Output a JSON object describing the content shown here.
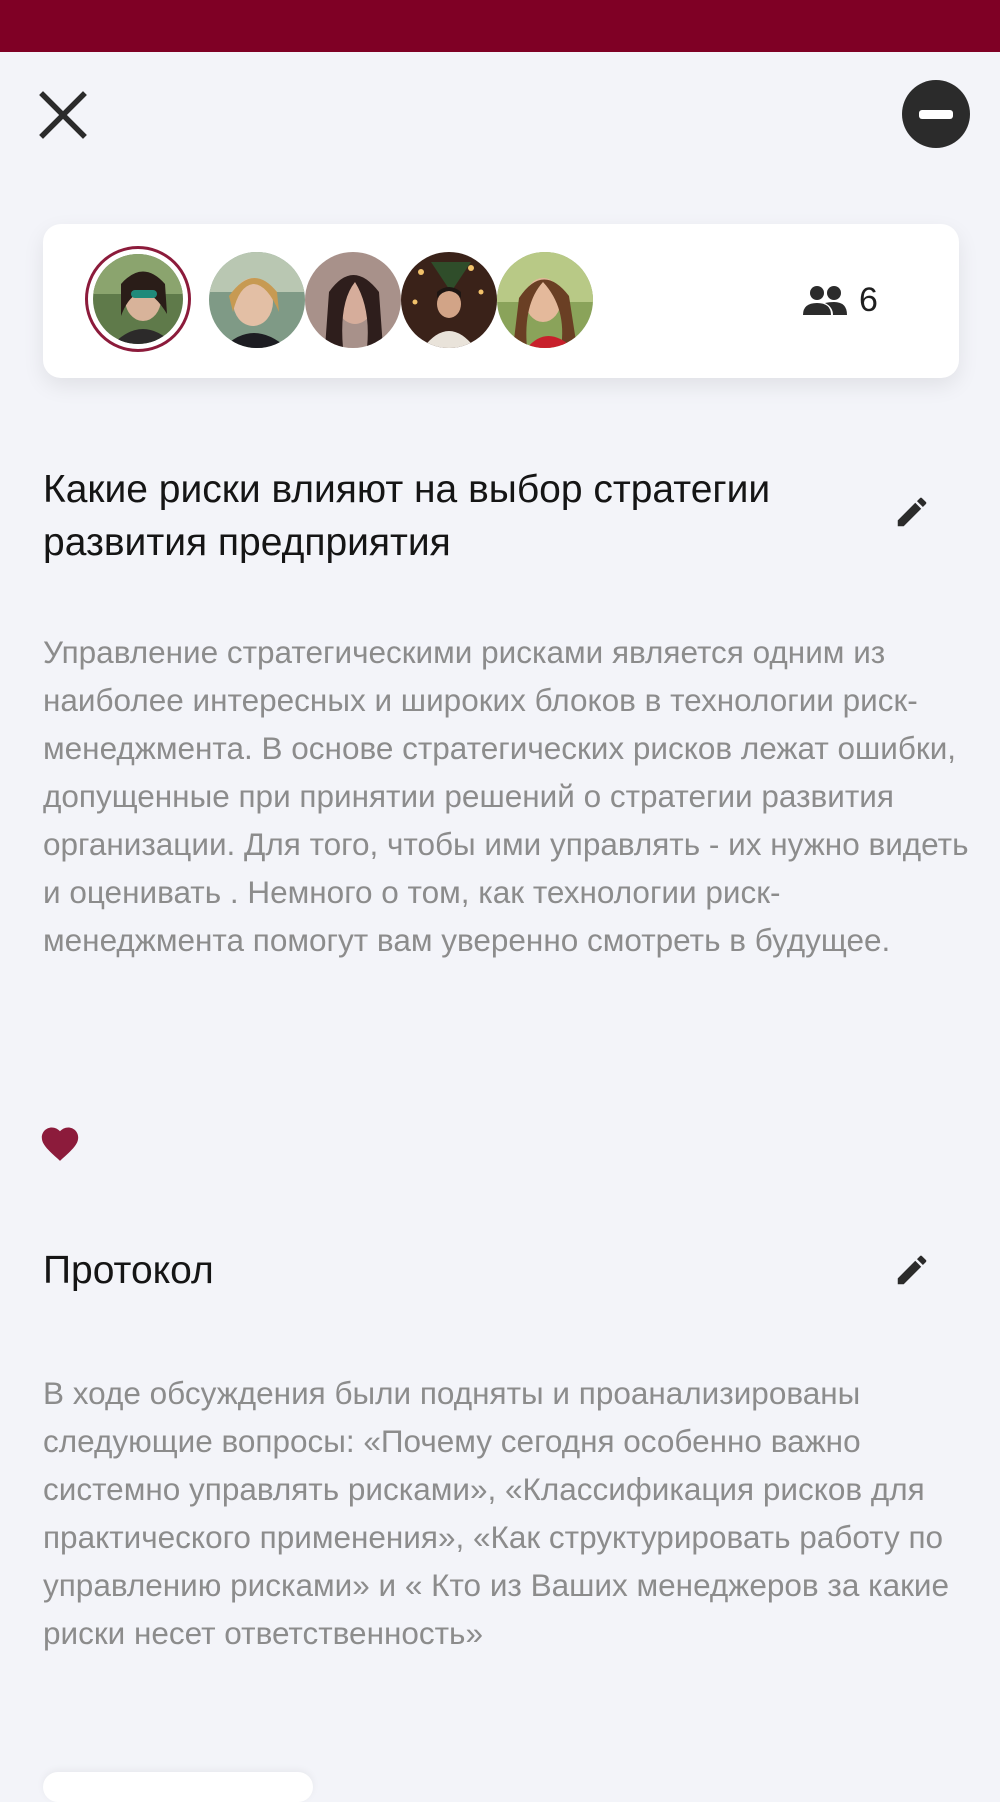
{
  "colors": {
    "status_bar": "#7f0025",
    "accent": "#8c1b3b",
    "background": "#f3f4f9"
  },
  "toolbar": {
    "close_icon": "close-icon",
    "leave_icon": "minus-circle-icon"
  },
  "members": {
    "avatars": [
      "avatar-user-1",
      "avatar-user-2",
      "avatar-user-3",
      "avatar-user-4",
      "avatar-user-5",
      "avatar-user-6"
    ],
    "count_icon": "people-icon",
    "count": "6"
  },
  "topic": {
    "title": "Какие риски влияют на выбор стратегии развития предприятия",
    "description": "Управление стратегическими рисками является одним из наиболее интересных и широких блоков в технологии риск-менеджмента. В основе стратегических рисков лежат ошибки, допущенные при принятии решений о стратегии развития организации. Для того, чтобы ими управлять - их нужно видеть и оценивать . Немного о том, как технологии риск-менеджмента помогут вам уверенно смотреть в будущее.",
    "edit_icon": "pencil-icon",
    "like_icon": "heart-icon"
  },
  "protocol": {
    "title": "Протокол",
    "text": "В ходе обсуждения были подняты и проанализированы следующие вопросы: «Почему сегодня особенно важно системно управлять рисками», «Классификация рисков для практического применения», «Как структурировать работу по управлению рисками» и « Кто из Ваших менеджеров за какие риски несет ответственность»",
    "edit_icon": "pencil-icon"
  }
}
